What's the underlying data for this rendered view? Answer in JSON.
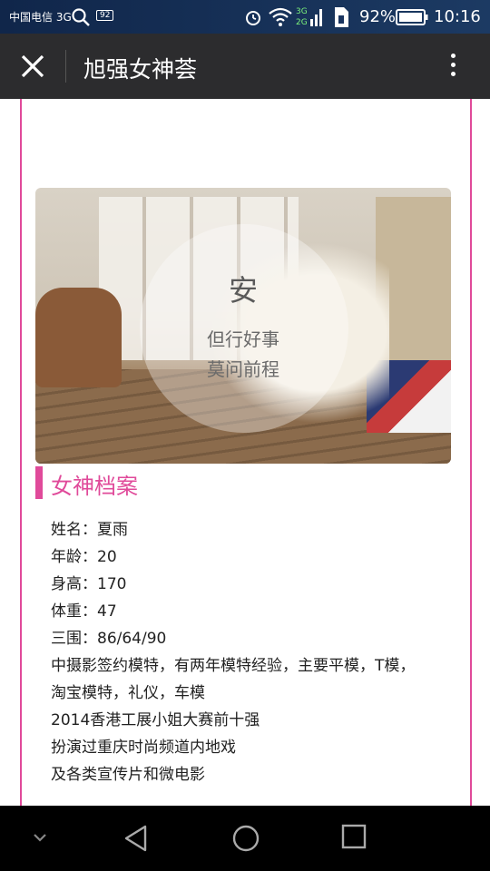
{
  "status_bar": {
    "carrier": "中国电信 3G",
    "badge": "92",
    "battery_percent": "92%",
    "time": "10:16",
    "icons": [
      "search-icon",
      "notification-badge-icon",
      "alarm-icon",
      "wifi-icon",
      "signal-icon",
      "sim-icon",
      "battery-icon"
    ]
  },
  "app_bar": {
    "title": "旭强女神荟",
    "icons": [
      "close-icon",
      "more-vert-icon"
    ]
  },
  "hero": {
    "overlay_title": "安",
    "overlay_line1": "但行好事",
    "overlay_line2": "莫问前程"
  },
  "profile": {
    "section_title": "女神档案",
    "lines": [
      "姓名：夏雨",
      "年龄：20",
      "身高：170",
      "体重：47",
      "三围：86/64/90",
      "中摄影签约模特，有两年模特经验，主要平模，T模，",
      "淘宝模特，礼仪，车模",
      "2014香港工展小姐大赛前十强",
      "扮演过重庆时尚频道内地戏",
      "及各类宣传片和微电影"
    ]
  },
  "nav_bar": {
    "icons": [
      "hide-keyboard-icon",
      "back-icon",
      "home-icon",
      "recents-icon"
    ]
  },
  "colors": {
    "accent": "#e04a9a",
    "appbar": "#2c2c2e"
  }
}
